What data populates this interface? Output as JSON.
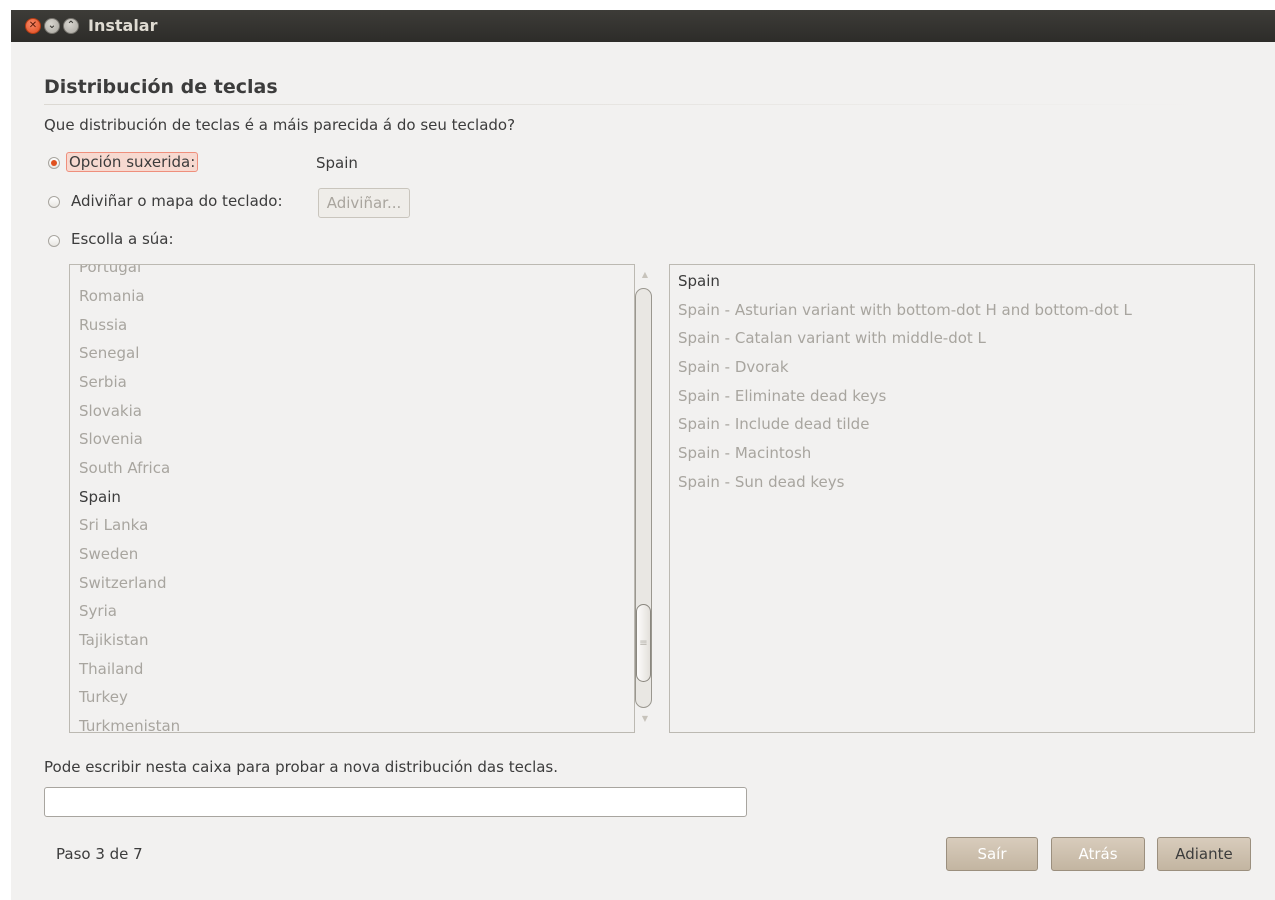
{
  "window": {
    "title": "Instalar"
  },
  "page": {
    "heading": "Distribución de teclas",
    "question": "Que distribución de teclas é a máis parecida á do seu teclado?"
  },
  "options": {
    "suggested_label": "Opción suxerida:",
    "suggested_value": "Spain",
    "guess_label": "Adiviñar o mapa do teclado:",
    "guess_button": "Adiviñar...",
    "choose_label": "Escolla a súa:",
    "selected": "suggested"
  },
  "countries": {
    "items": [
      "Portugal",
      "Romania",
      "Russia",
      "Senegal",
      "Serbia",
      "Slovakia",
      "Slovenia",
      "South Africa",
      "Spain",
      "Sri Lanka",
      "Sweden",
      "Switzerland",
      "Syria",
      "Tajikistan",
      "Thailand",
      "Turkey",
      "Turkmenistan"
    ],
    "selected": "Spain"
  },
  "variants": {
    "items": [
      "Spain",
      "Spain - Asturian variant with bottom-dot H and bottom-dot L",
      "Spain - Catalan variant with middle-dot L",
      "Spain - Dvorak",
      "Spain - Eliminate dead keys",
      "Spain - Include dead tilde",
      "Spain - Macintosh",
      "Spain - Sun dead keys"
    ],
    "selected": "Spain"
  },
  "test": {
    "hint": "Pode escribir nesta caixa para probar a nova distribución das teclas.",
    "value": "",
    "placeholder": ""
  },
  "footer": {
    "step": "Paso 3 de 7",
    "quit": "Saír",
    "back": "Atrás",
    "forward": "Adiante"
  },
  "colors": {
    "accent": "#e0501e",
    "titlebar": "#3d3c38",
    "button": "#c8bba8",
    "background": "#f2f1f0"
  },
  "icons": {
    "close": "close-icon",
    "minimize": "minimize-icon",
    "maximize": "maximize-icon"
  }
}
